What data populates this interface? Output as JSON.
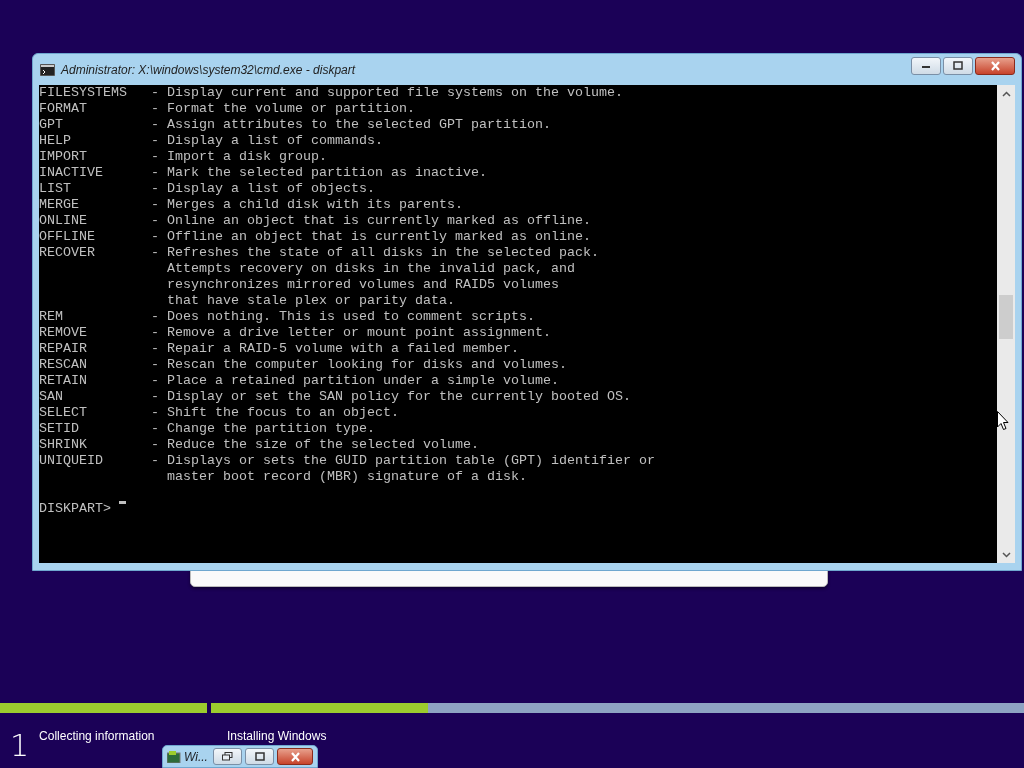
{
  "console_window": {
    "title": "Administrator: X:\\windows\\system32\\cmd.exe - diskpart",
    "entries": [
      {
        "command": "FILESYSTEMS",
        "separator": "-",
        "description": [
          "Display current and supported file systems on the volume."
        ]
      },
      {
        "command": "FORMAT",
        "separator": "-",
        "description": [
          "Format the volume or partition."
        ]
      },
      {
        "command": "GPT",
        "separator": "-",
        "description": [
          "Assign attributes to the selected GPT partition."
        ]
      },
      {
        "command": "HELP",
        "separator": "-",
        "description": [
          "Display a list of commands."
        ]
      },
      {
        "command": "IMPORT",
        "separator": "-",
        "description": [
          "Import a disk group."
        ]
      },
      {
        "command": "INACTIVE",
        "separator": "-",
        "description": [
          "Mark the selected partition as inactive."
        ]
      },
      {
        "command": "LIST",
        "separator": "-",
        "description": [
          "Display a list of objects."
        ]
      },
      {
        "command": "MERGE",
        "separator": "-",
        "description": [
          "Merges a child disk with its parents."
        ]
      },
      {
        "command": "ONLINE",
        "separator": "-",
        "description": [
          "Online an object that is currently marked as offline."
        ]
      },
      {
        "command": "OFFLINE",
        "separator": "-",
        "description": [
          "Offline an object that is currently marked as online."
        ]
      },
      {
        "command": "RECOVER",
        "separator": "-",
        "description": [
          "Refreshes the state of all disks in the selected pack.",
          "Attempts recovery on disks in the invalid pack, and",
          "resynchronizes mirrored volumes and RAID5 volumes",
          "that have stale plex or parity data."
        ]
      },
      {
        "command": "REM",
        "separator": "-",
        "description": [
          "Does nothing. This is used to comment scripts."
        ]
      },
      {
        "command": "REMOVE",
        "separator": "-",
        "description": [
          "Remove a drive letter or mount point assignment."
        ]
      },
      {
        "command": "REPAIR",
        "separator": "-",
        "description": [
          "Repair a RAID-5 volume with a failed member."
        ]
      },
      {
        "command": "RESCAN",
        "separator": "-",
        "description": [
          "Rescan the computer looking for disks and volumes."
        ]
      },
      {
        "command": "RETAIN",
        "separator": "-",
        "description": [
          "Place a retained partition under a simple volume."
        ]
      },
      {
        "command": "SAN",
        "separator": "-",
        "description": [
          "Display or set the SAN policy for the currently booted OS."
        ]
      },
      {
        "command": "SELECT",
        "separator": "-",
        "description": [
          "Shift the focus to an object."
        ]
      },
      {
        "command": "SETID",
        "separator": "-",
        "description": [
          "Change the partition type."
        ]
      },
      {
        "command": "SHRINK",
        "separator": "-",
        "description": [
          "Reduce the size of the selected volume."
        ]
      },
      {
        "command": "UNIQUEID",
        "separator": "-",
        "description": [
          "Displays or sets the GUID partition table (GPT) identifier or",
          "master boot record (MBR) signature of a disk."
        ]
      }
    ],
    "prompt": "DISKPART>"
  },
  "progress": [
    {
      "level": 1
    },
    {
      "level": 0.267
    }
  ],
  "steps": [
    {
      "number": "1",
      "label": "Collecting information"
    },
    {
      "label": "Installing Windows"
    }
  ],
  "minimized_window": {
    "title": "Wi..."
  }
}
